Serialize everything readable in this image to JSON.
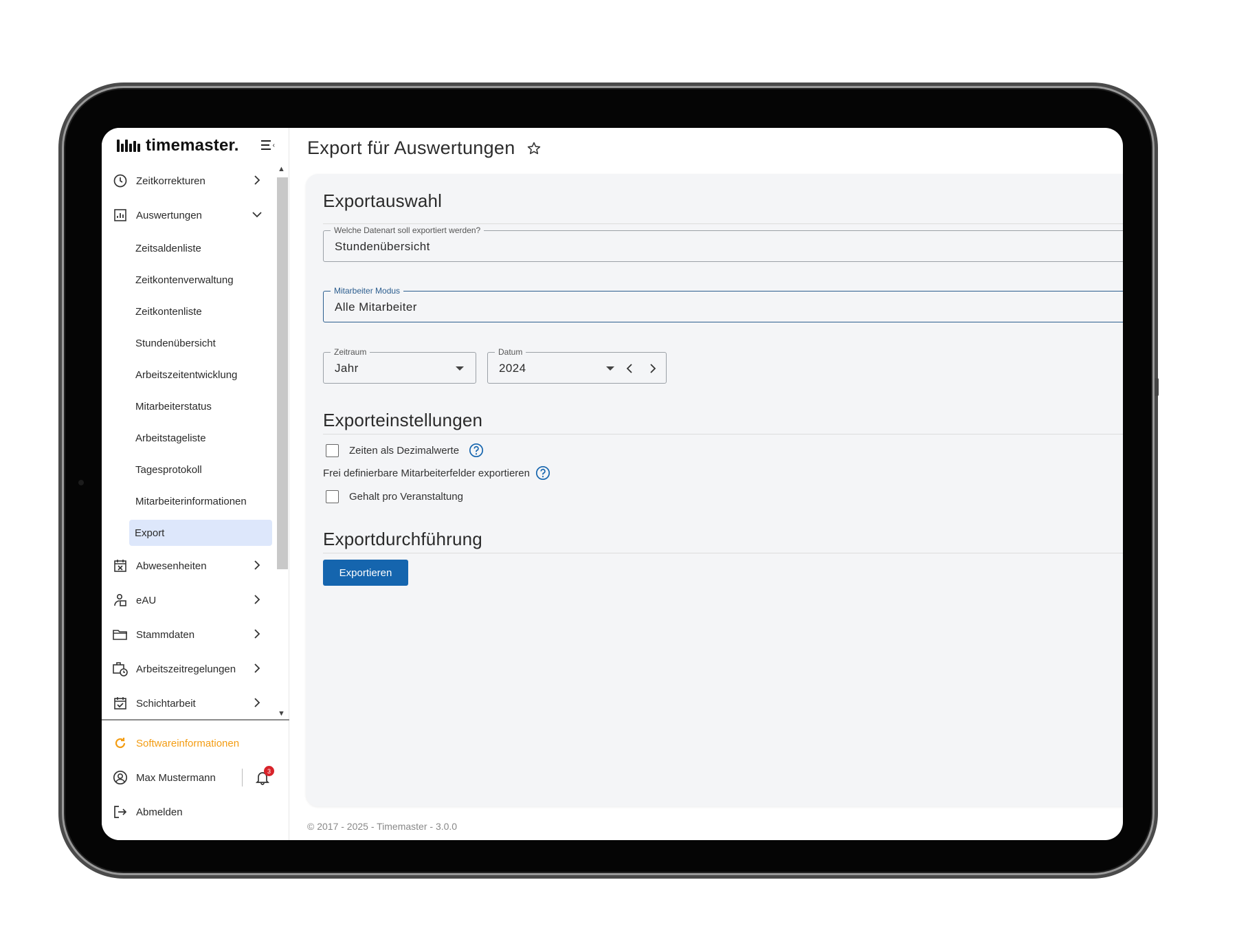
{
  "brand": {
    "name": "timemaster."
  },
  "sidebar": {
    "items_top": [
      {
        "label": "Zeitkorrekturen",
        "icon": "clock-icon"
      },
      {
        "label": "Auswertungen",
        "icon": "chart-icon"
      }
    ],
    "sub_items": [
      "Zeitsaldenliste",
      "Zeitkontenverwaltung",
      "Zeitkontenliste",
      "Stundenübersicht",
      "Arbeitszeitentwicklung",
      "Mitarbeiterstatus",
      "Arbeitstageliste",
      "Tagesprotokoll",
      "Mitarbeiterinformationen",
      "Export"
    ],
    "items_bottom": [
      {
        "label": "Abwesenheiten",
        "icon": "calendar-x-icon"
      },
      {
        "label": "eAU",
        "icon": "person-doc-icon"
      },
      {
        "label": "Stammdaten",
        "icon": "folder-icon"
      },
      {
        "label": "Arbeitszeitregelungen",
        "icon": "briefcase-clock-icon"
      },
      {
        "label": "Schichtarbeit",
        "icon": "calendar-check-icon"
      }
    ],
    "footer": {
      "software_info": "Softwareinformationen",
      "user": "Max Mustermann",
      "notifications": "3",
      "logout": "Abmelden"
    }
  },
  "page": {
    "title": "Export für Auswertungen",
    "sections": {
      "selection": "Exportauswahl",
      "settings": "Exporteinstellungen",
      "execution": "Exportdurchführung"
    },
    "fields": {
      "datatype": {
        "label": "Welche Datenart soll exportiert werden?",
        "value": "Stundenübersicht"
      },
      "employee_mode": {
        "label": "Mitarbeiter Modus",
        "value": "Alle Mitarbeiter"
      },
      "period": {
        "label": "Zeitraum",
        "value": "Jahr"
      },
      "date": {
        "label": "Datum",
        "value": "2024"
      }
    },
    "settings": {
      "decimal": "Zeiten als Dezimalwerte",
      "custom_fields": "Frei definierbare Mitarbeiterfelder exportieren",
      "salary": "Gehalt pro Veranstaltung"
    },
    "export_button": "Exportieren",
    "footer": "© 2017 - 2025 - Timemaster - 3.0.0"
  },
  "colors": {
    "accent": "#1565ae",
    "active_bg": "#dde7fb",
    "software_info": "#f39c12",
    "badge": "#d8232a"
  }
}
